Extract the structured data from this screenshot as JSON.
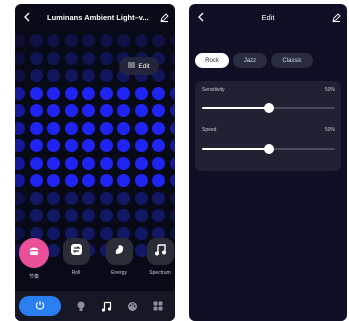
{
  "left_screen": {
    "title": "Luminans Ambient Light–v...",
    "edit_button_label": "Edit",
    "effects": [
      {
        "label": "节奏",
        "icon": "music-cap-icon",
        "active": true
      },
      {
        "label": "Roll",
        "icon": "repeat-icon",
        "active": false
      },
      {
        "label": "Energy",
        "icon": "energy-icon",
        "active": false
      },
      {
        "label": "Spectrum",
        "icon": "music-note-icon",
        "active": false
      }
    ],
    "bottom_nav": [
      {
        "icon": "power-icon",
        "active": true
      },
      {
        "icon": "bulb-icon",
        "active": false
      },
      {
        "icon": "music-icon",
        "active": false
      },
      {
        "icon": "palette-icon",
        "active": false
      },
      {
        "icon": "grid-icon",
        "active": false
      }
    ]
  },
  "right_screen": {
    "title": "Edit",
    "genres": [
      {
        "label": "Rock",
        "selected": true
      },
      {
        "label": "Jazz",
        "selected": false
      },
      {
        "label": "Classic",
        "selected": false
      }
    ],
    "controls": [
      {
        "label": "Sensitivity",
        "value_text": "50%",
        "value": 0.5
      },
      {
        "label": "Speed",
        "value_text": "50%",
        "value": 0.5
      }
    ]
  },
  "colors": {
    "accent_blue": "#2b7ef0",
    "accent_pink": "#ea4f9a",
    "dot_bright": "#1f24f2",
    "dot_dim": "#15196e"
  }
}
